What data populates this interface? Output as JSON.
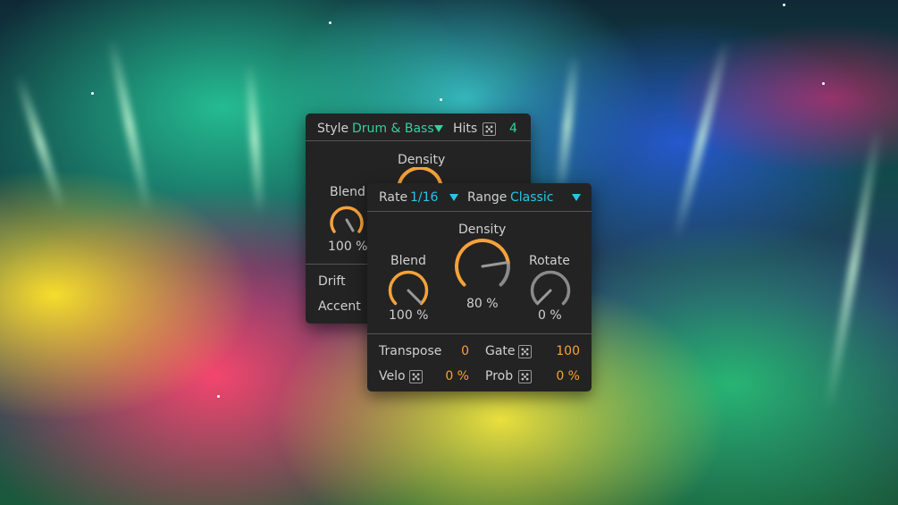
{
  "back_panel": {
    "style_label": "Style",
    "style_value": "Drum & Bass",
    "hits_label": "Hits",
    "hits_value": "4",
    "density_label": "Density",
    "blend_label": "Blend",
    "blend_value": "100 %",
    "drift_label": "Drift",
    "accent_label": "Accent"
  },
  "front_panel": {
    "rate_label": "Rate",
    "rate_value": "1/16",
    "range_label": "Range",
    "range_value": "Classic",
    "density_label": "Density",
    "density_value": "80 %",
    "density_level": 0.8,
    "blend_label": "Blend",
    "blend_value": "100 %",
    "blend_level": 1.0,
    "rotate_label": "Rotate",
    "rotate_value": "0 %",
    "rotate_level": 0.0,
    "transpose_label": "Transpose",
    "transpose_value": "0",
    "gate_label": "Gate",
    "gate_value": "100",
    "velo_label": "Velo",
    "velo_value": "0 %",
    "prob_label": "Prob",
    "prob_value": "0 %"
  },
  "colors": {
    "accent_green": "#2ed3a0",
    "accent_cyan": "#27c6e8",
    "accent_orange": "#f5a23a",
    "panel_bg": "#232323",
    "knob_track": "#8a8a8a"
  },
  "icons": {
    "random": "dice-icon",
    "dropdown": "triangle-down-icon"
  }
}
